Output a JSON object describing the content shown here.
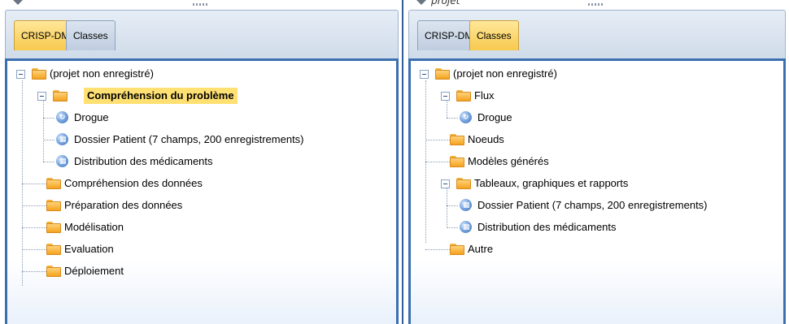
{
  "top_bar": {
    "right_caption": "projet"
  },
  "left_pane": {
    "tabs": [
      {
        "label": "CRISP-DM",
        "active": true
      },
      {
        "label": "Classes",
        "active": false
      }
    ],
    "root": "(projet non enregistré)",
    "phase_selected": "Compréhension du problème",
    "phase_children": [
      {
        "label": "Drogue",
        "icon": "stream-node-icon"
      },
      {
        "label": "Dossier Patient (7 champs, 200 enregistrements)",
        "icon": "table-output-icon"
      },
      {
        "label": "Distribution des médicaments",
        "icon": "table-output-icon"
      }
    ],
    "phases": [
      "Compréhension des données",
      "Préparation des données",
      "Modélisation",
      "Evaluation",
      "Déploiement"
    ]
  },
  "right_pane": {
    "tabs": [
      {
        "label": "CRISP-DM",
        "active": false
      },
      {
        "label": "Classes",
        "active": true
      }
    ],
    "root": "(projet non enregistré)",
    "flux": {
      "label": "Flux",
      "children": [
        "Drogue"
      ]
    },
    "noeuds": "Noeuds",
    "modeles": "Modèles générés",
    "tableaux": {
      "label": "Tableaux, graphiques et rapports",
      "children": [
        "Dossier Patient (7 champs, 200 enregistrements)",
        "Distribution des médicaments"
      ]
    },
    "autre": "Autre"
  },
  "colors": {
    "active_tab": "#f7c94e",
    "selection": "#ffe173",
    "border_blue": "#3a6fb0"
  }
}
